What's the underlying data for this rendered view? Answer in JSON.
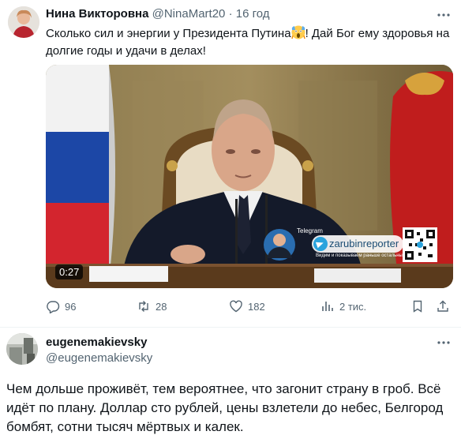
{
  "tweet1": {
    "author_name": "Нина Викторовна",
    "author_handle": "@NinaMart20",
    "separator": "·",
    "time": "16 год",
    "text_before_emoji": "Сколько сил и энергии у Президента Путина",
    "emoji": "scream-emoji",
    "text_after_emoji": "! Дай Бог ему здоровья на долгие годы и удачи в делах!",
    "media": {
      "duration": "0:27",
      "watermark_tag": "Telegram",
      "watermark_channel": "zarubinreporter",
      "watermark_slogan": "Видим и показываем раньше остальных"
    },
    "actions": {
      "replies": "96",
      "reposts": "28",
      "likes": "182",
      "views": "2 тис."
    }
  },
  "tweet2": {
    "author_name": "eugenemakievsky",
    "author_handle": "@eugenemakievsky",
    "text": "Чем дольше проживёт, тем вероятнее, что загонит страну в гроб. Всё идёт по плану. Доллар сто рублей, цены взлетели до небес, Белгород бомбят, сотни тысяч мёртвых и калек."
  },
  "icons": {
    "reply": "reply-icon",
    "repost": "repost-icon",
    "like": "like-icon",
    "views": "views-icon",
    "bookmark": "bookmark-icon",
    "share": "share-icon",
    "more": "more-icon"
  },
  "colors": {
    "text": "#0f1419",
    "secondary": "#536471",
    "divider": "#eff3f4"
  }
}
